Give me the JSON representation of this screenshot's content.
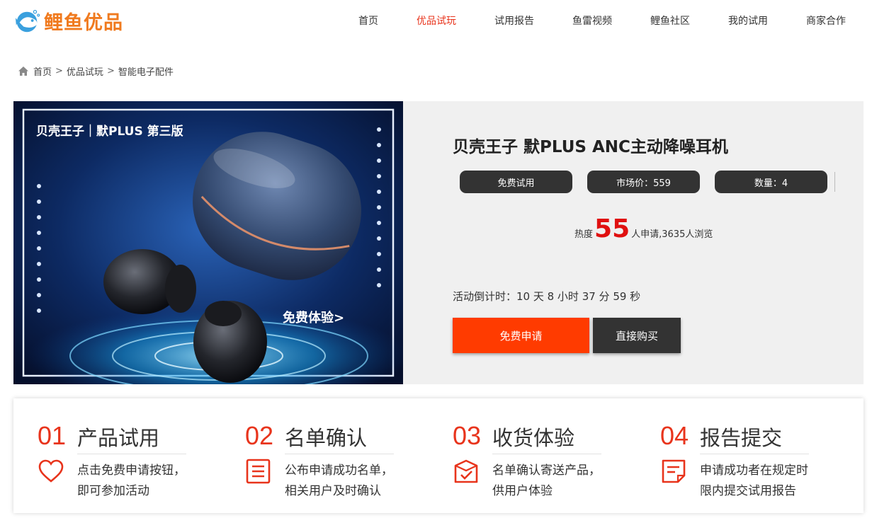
{
  "brand": {
    "name": "鲤鱼优品",
    "color": "#f07a1e",
    "logo_icon": "fish-logo-icon"
  },
  "nav": {
    "items": [
      {
        "label": "首页",
        "active": false
      },
      {
        "label": "优品试玩",
        "active": true
      },
      {
        "label": "试用报告",
        "active": false
      },
      {
        "label": "鱼雷视频",
        "active": false
      },
      {
        "label": "鲤鱼社区",
        "active": false
      },
      {
        "label": "我的试用",
        "active": false
      },
      {
        "label": "商家合作",
        "active": false
      }
    ],
    "active_color": "#e8341c"
  },
  "breadcrumb": {
    "icon": "home-icon",
    "items": [
      "首页",
      "优品试玩",
      "智能电子配件"
    ],
    "separator": ">"
  },
  "product": {
    "image": {
      "brand_line": "贝壳王子｜默PLUS 第三版",
      "cta": "免费体验>"
    },
    "title": "贝壳王子 默PLUS ANC主动降噪耳机",
    "tags": [
      "免费试用",
      "市场价：559",
      "数量：4"
    ],
    "heat": {
      "prefix": "热度",
      "count": "55",
      "suffix": "人申请,3635人浏览"
    },
    "countdown": "活动倒计时：10 天 8 小时 37 分 59 秒",
    "apply_button": "免费申请",
    "buy_button": "直接购买",
    "apply_color": "#ff3b00"
  },
  "steps": [
    {
      "num": "01",
      "title": "产品试用",
      "icon": "heart-icon",
      "lines": [
        "点击免费申请按钮，",
        "即可参加活动"
      ]
    },
    {
      "num": "02",
      "title": "名单确认",
      "icon": "list-icon",
      "lines": [
        "公布申请成功名单，",
        "相关用户及时确认"
      ]
    },
    {
      "num": "03",
      "title": "收货体验",
      "icon": "package-check-icon",
      "lines": [
        "名单确认寄送产品，",
        "供用户体验"
      ]
    },
    {
      "num": "04",
      "title": "报告提交",
      "icon": "report-icon",
      "lines": [
        "申请成功者在规定时",
        "限内提交试用报告"
      ]
    }
  ],
  "accent_color": "#e8341c"
}
